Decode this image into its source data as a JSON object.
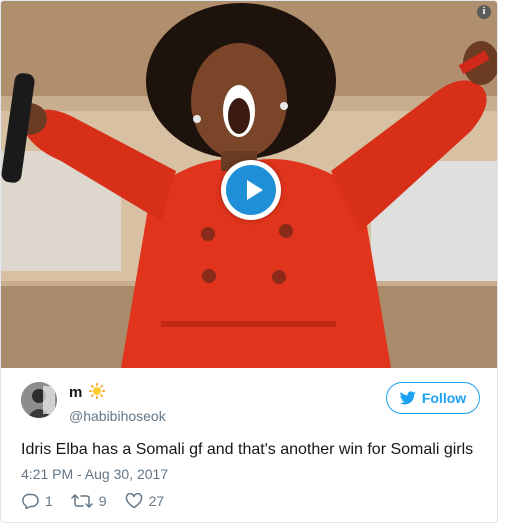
{
  "tweet": {
    "display_name": "m",
    "handle": "@habibihoseok",
    "follow_label": "Follow",
    "text": "Idris Elba has a Somali gf and that's another win for Somali girls",
    "timestamp": "4:21 PM - Aug 30, 2017",
    "reply_count": "1",
    "retweet_count": "9",
    "like_count": "27"
  },
  "colors": {
    "accent": "#1da1f2",
    "muted": "#657786",
    "play_button": "#1f8fd8",
    "outfit": "#e0341c"
  },
  "icons": [
    "info-icon",
    "play-icon",
    "sun-emoji",
    "twitter-bird-icon",
    "reply-icon",
    "retweet-icon",
    "like-icon"
  ]
}
